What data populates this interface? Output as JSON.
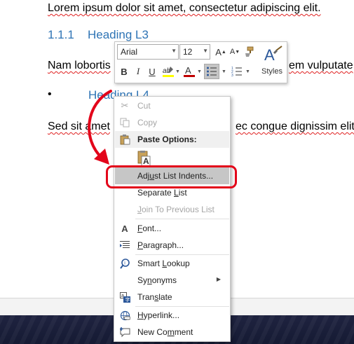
{
  "document": {
    "line1": "Lorem ipsum dolor sit amet, consectetur adipiscing elit.",
    "heading3_number": "1.1.1",
    "heading3_text": "Heading L3",
    "line2_left": "Nam lobortis",
    "line2_right": "em vulputate",
    "bullet": "•",
    "heading4_text": "Heading L4",
    "line3_left": "Sed sit amet",
    "line3_right": "ec congue dignissim elit"
  },
  "mini_toolbar": {
    "font_name": "Arial",
    "font_size": "12",
    "styles_label": "Styles",
    "icons": [
      "grow-font-icon",
      "shrink-font-icon",
      "format-painter-icon",
      "styles-icon",
      "bold-icon",
      "italic-icon",
      "underline-icon",
      "highlight-icon",
      "font-color-icon",
      "bullets-icon",
      "numbering-icon"
    ]
  },
  "context_menu": {
    "cut": "Cut",
    "copy": "Copy",
    "paste_options": "Paste Options:",
    "paste_keep_text": "A",
    "adjust_indents_pre": "Adj",
    "adjust_indents_u": "u",
    "adjust_indents_post": "st List Indents...",
    "separate_list_pre": "Separate ",
    "separate_list_u": "L",
    "separate_list_post": "ist",
    "join_list_u": "J",
    "join_list_post": "oin To Previous List",
    "font_u": "F",
    "font_post": "ont...",
    "paragraph_u": "P",
    "paragraph_post": "aragraph...",
    "smart_lookup_pre": "Smart ",
    "smart_lookup_u": "L",
    "smart_lookup_post": "ookup",
    "synonyms_pre": "Sy",
    "synonyms_u": "n",
    "synonyms_post": "onyms",
    "translate_pre": "Tran",
    "translate_u": "s",
    "translate_post": "late",
    "hyperlink_u": "H",
    "hyperlink_post": "yperlink...",
    "new_comment_pre": "New Co",
    "new_comment_u": "m",
    "new_comment_post": "ment"
  },
  "annotation": {
    "color": "#e3051a"
  }
}
